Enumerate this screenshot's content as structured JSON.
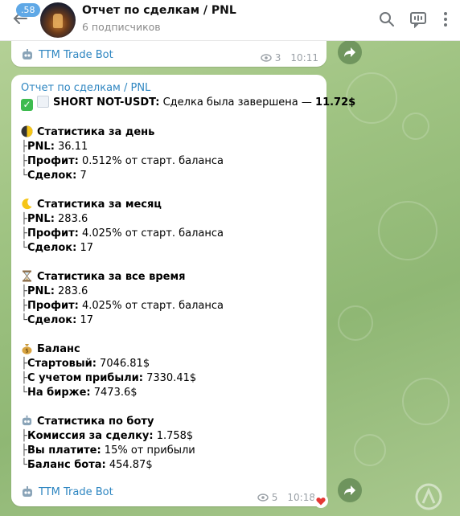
{
  "header": {
    "unread_count": "58",
    "title": "Отчет по сделкам / PNL",
    "subtitle": "6 подписчиков"
  },
  "prev_message": {
    "bot_name": "TTM Trade Bot",
    "views": "3",
    "time": "10:11"
  },
  "message": {
    "channel_title": "Отчет по сделкам / PNL",
    "headline_bold": "SHORT NOT-USDT:",
    "headline_text": " Сделка была завершена — ",
    "headline_amount": "11.72$",
    "sections": [
      {
        "title": "Статистика за день",
        "icon": "half-moon-icon",
        "rows": [
          {
            "prefix": "├",
            "label": "PNL:",
            "value": " 36.11"
          },
          {
            "prefix": "├",
            "label": "Профит:",
            "value": " 0.512% от старт. баланса"
          },
          {
            "prefix": "└",
            "label": "Сделок:",
            "value": " 7"
          }
        ]
      },
      {
        "title": "Статистика за месяц",
        "icon": "crescent-moon-icon",
        "rows": [
          {
            "prefix": "├",
            "label": "PNL:",
            "value": " 283.6"
          },
          {
            "prefix": "├",
            "label": "Профит:",
            "value": " 4.025% от старт. баланса"
          },
          {
            "prefix": "└",
            "label": "Сделок:",
            "value": " 17"
          }
        ]
      },
      {
        "title": "Статистика за все время",
        "icon": "hourglass-icon",
        "rows": [
          {
            "prefix": "├",
            "label": "PNL:",
            "value": " 283.6"
          },
          {
            "prefix": "├",
            "label": "Профит:",
            "value": " 4.025% от старт. баланса"
          },
          {
            "prefix": "└",
            "label": "Сделок:",
            "value": " 17"
          }
        ]
      },
      {
        "title": "Баланс",
        "icon": "money-bag-icon",
        "rows": [
          {
            "prefix": "├",
            "label": "Стартовый:",
            "value": " 7046.81$"
          },
          {
            "prefix": "├",
            "label": "С учетом прибыли:",
            "value": " 7330.41$"
          },
          {
            "prefix": "└",
            "label": "На бирже:",
            "value": " 7473.6$"
          }
        ]
      },
      {
        "title": "Статистика по боту",
        "icon": "robot-icon",
        "rows": [
          {
            "prefix": "├",
            "label": "Комиссия за сделку:",
            "value": " 1.758$"
          },
          {
            "prefix": "├",
            "label": "Вы платите:",
            "value": " 15% от прибыли"
          },
          {
            "prefix": "└",
            "label": "Баланс бота:",
            "value": " 454.87$"
          }
        ]
      }
    ],
    "bot_name": "TTM Trade Bot",
    "views": "5",
    "time": "10:18"
  },
  "colors": {
    "accent": "#2e86c1",
    "badge": "#5fa8e6",
    "reaction": "#e53935"
  }
}
